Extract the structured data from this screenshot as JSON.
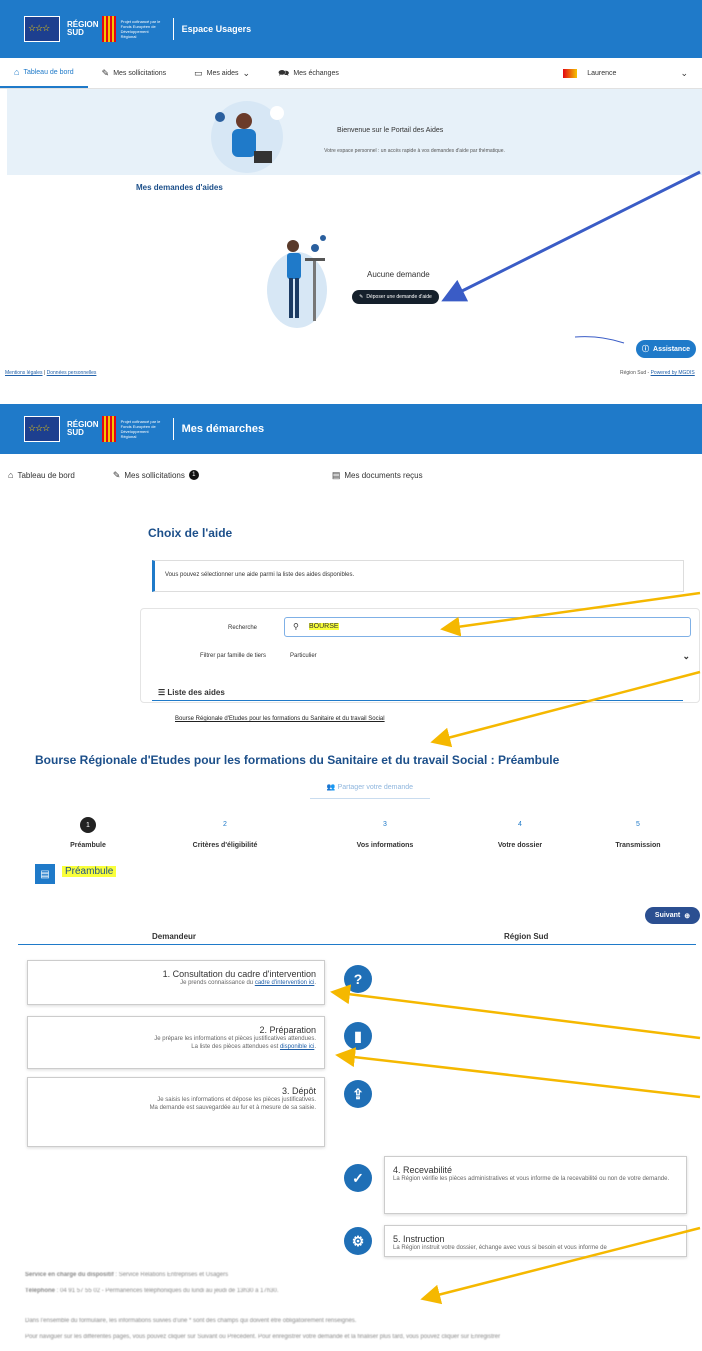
{
  "portal": {
    "header": {
      "region_line1": "RÉGION",
      "region_line2": "SUD",
      "fund_text": "Projet cofinancé par le Fonds Européen de Développement Régional",
      "title": "Espace Usagers"
    },
    "nav": {
      "dashboard": "Tableau de bord",
      "solicitations": "Mes sollicitations",
      "aids": "Mes aides",
      "exchanges": "Mes échanges",
      "user": "Laurence"
    },
    "welcome": {
      "title": "Bienvenue sur le Portail des Aides",
      "text": "Votre espace personnel : un accès rapide à vos demandes d'aide par thématique."
    },
    "requests": {
      "title": "Mes demandes d'aides",
      "empty": "Aucune demande",
      "deposit_btn": "Déposer une demande d'aide"
    },
    "assist": "Assistance",
    "footer": {
      "legal": "Mentions légales",
      "sep": "|",
      "personal": "Données personnelles",
      "credit": "Région Sud - ",
      "powered": "Powered by MGDIS"
    }
  },
  "demarches": {
    "header": {
      "title": "Mes démarches"
    },
    "nav": {
      "dashboard": "Tableau de bord",
      "solicitations": "Mes sollicitations",
      "badge": "1",
      "docs": "Mes documents reçus"
    },
    "choice_title": "Choix de l'aide",
    "info": "Vous pouvez sélectionner une aide parmi la liste des aides disponibles.",
    "search_label": "Recherche",
    "search_value": "BOURSE",
    "filter_label": "Filtrer par famille de tiers",
    "filter_value": "Particulier",
    "list_title": "Liste des aides",
    "aid_link": "Bourse Régionale d'Etudes pour les formations du Sanitaire et du travail Social"
  },
  "preambule": {
    "page_title": "Bourse Régionale d'Etudes pour les formations du Sanitaire et du travail Social : Préambule",
    "share": "Partager votre demande",
    "steps": [
      {
        "num": "1",
        "label": "Préambule"
      },
      {
        "num": "2",
        "label": "Critères d'éligibilité"
      },
      {
        "num": "3",
        "label": "Vos informations"
      },
      {
        "num": "4",
        "label": "Votre dossier"
      },
      {
        "num": "5",
        "label": "Transmission"
      }
    ],
    "section": "Préambule",
    "next": "Suivant",
    "col_left": "Demandeur",
    "col_right": "Région Sud",
    "cards": [
      {
        "title": "1. Consultation du cadre d'intervention",
        "text": "Je prends connaissance du ",
        "link": "cadre d'intervention ici",
        "end": "."
      },
      {
        "title": "2. Préparation",
        "text": "Je prépare les informations et pièces justificatives attendues.",
        "text2": "La liste des pièces attendues est ",
        "link": "disponible ici",
        "end": "."
      },
      {
        "title": "3. Dépôt",
        "text": "Je saisis les informations et dépose les pièces justificatives.",
        "text2": "Ma demande est sauvegardée au fur et à mesure de sa saisie."
      },
      {
        "title": "4. Recevabilité",
        "text": "La Région vérifie les pièces administratives et vous informe de la recevabilité ou non de votre demande."
      },
      {
        "title": "5. Instruction",
        "text": "La Région instruit votre dossier, échange avec vous si besoin et vous informe de"
      }
    ],
    "service_label": "Service en charge du dispositif",
    "service_value": " : Service Relations Entreprises et Usagers",
    "phone_label": "Téléphone",
    "phone_value": " : 04 91 57 55 02 - Permanences téléphoniques du lundi au jeudi de 13h30 à 17h30.",
    "note1": "Dans l'ensemble du formulaire, les informations suivies d'une * sont des champs qui doivent être obligatoirement renseignés.",
    "note2": "Pour naviguer sur les différentes pages, vous pouvez cliquer sur Suivant ou Précédent. Pour enregistrer votre demande et la finaliser plus tard, vous pouvez cliquer sur Enregistrer"
  },
  "colors": {
    "primary": "#1f7ac9",
    "arrow_blue": "#3a5cc6",
    "arrow_yellow": "#f5b800",
    "highlight": "#f9ff3b"
  }
}
